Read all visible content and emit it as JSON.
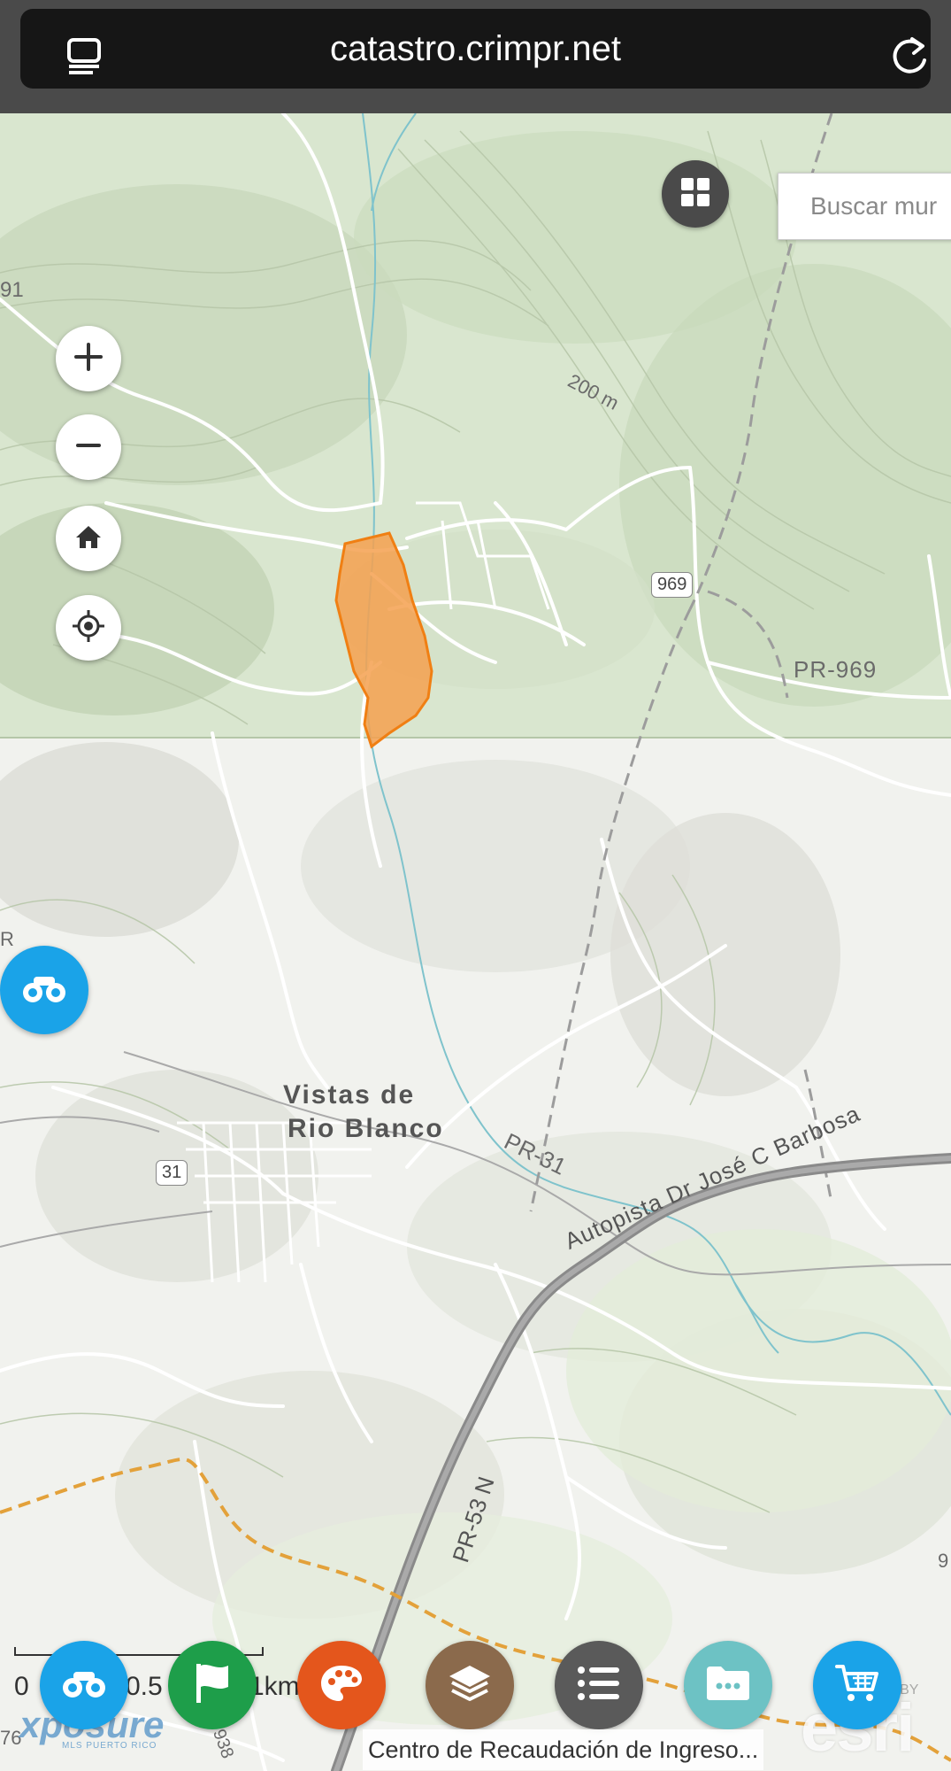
{
  "browser": {
    "url": "catastro.crimpr.net",
    "tabs_icon": "tabs-icon",
    "reload_icon": "reload-icon"
  },
  "search": {
    "placeholder": "Buscar mur"
  },
  "map": {
    "labels": {
      "top_left_number": "91",
      "contour_200": "200 m",
      "route_969_shield": "969",
      "pr969": "PR-969",
      "town_line1": "Vistas de",
      "town_line2": "Rio Blanco",
      "pr31": "PR-31",
      "route_31_shield": "31",
      "autopista": "Autopista Dr José C Barbosa",
      "pr53n": "PR-53 N",
      "left_edge_r": "R",
      "route_938": "938",
      "right_edge_9": "9",
      "left_bottom": "76"
    },
    "parcel_color": "#f5a04f",
    "parcel_outline": "#f07f13"
  },
  "controls": {
    "zoom_in": "zoom-in-icon",
    "zoom_out": "zoom-out-icon",
    "home": "home-icon",
    "locate": "locate-icon",
    "grid": "grid-icon"
  },
  "scale": {
    "zero": "0",
    "half": "0.5",
    "one": "1km"
  },
  "toolbar": {
    "buttons": [
      {
        "icon": "binoculars-icon",
        "color": "#1aa3e8"
      },
      {
        "icon": "flag-icon",
        "color": "#1e9e4a"
      },
      {
        "icon": "palette-icon",
        "color": "#e4561c"
      },
      {
        "icon": "layers-icon",
        "color": "#8b6a4c"
      },
      {
        "icon": "list-icon",
        "color": "#5a5a5a"
      },
      {
        "icon": "folder-icon",
        "color": "#6dc2c4"
      },
      {
        "icon": "cart-icon",
        "color": "#1aa3e8"
      }
    ]
  },
  "attribution": "Centro de Recaudación de Ingreso...",
  "logos": {
    "esri": "esri",
    "powered": "POWERED BY",
    "xposure": "xposure",
    "xposure_sub": "MLS PUERTO RICO"
  }
}
